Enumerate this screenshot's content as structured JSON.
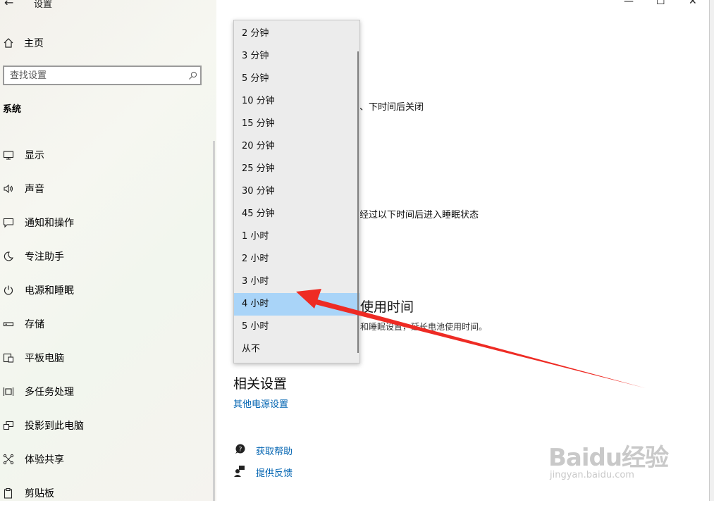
{
  "window": {
    "title": "设置",
    "back_glyph": "←",
    "minimize_glyph": "—",
    "maximize_glyph": "☐",
    "close_glyph": "✕"
  },
  "sidebar": {
    "home_label": "主页",
    "search_placeholder": "查找设置",
    "section_title": "系统",
    "items": [
      {
        "label": "显示",
        "icon": "monitor-icon"
      },
      {
        "label": "声音",
        "icon": "speaker-icon"
      },
      {
        "label": "通知和操作",
        "icon": "notification-icon"
      },
      {
        "label": "专注助手",
        "icon": "moon-icon"
      },
      {
        "label": "电源和睡眠",
        "icon": "power-icon"
      },
      {
        "label": "存储",
        "icon": "storage-icon"
      },
      {
        "label": "平板电脑",
        "icon": "tablet-icon"
      },
      {
        "label": "多任务处理",
        "icon": "multitask-icon"
      },
      {
        "label": "投影到此电脑",
        "icon": "project-icon"
      },
      {
        "label": "体验共享",
        "icon": "share-icon"
      },
      {
        "label": "剪贴板",
        "icon": "clipboard-icon"
      }
    ]
  },
  "main": {
    "screen_fragment": "、下时间后关闭",
    "sleep_fragment": "经过以下时间后进入睡眠状态",
    "battery_heading_fragment": "使用时间",
    "battery_desc_fragment": "和睡眠设置，延长电池使用时间。",
    "related_title": "相关设置",
    "related_link": "其他电源设置",
    "help_label": "获取帮助",
    "feedback_label": "提供反馈"
  },
  "dropdown": {
    "options": [
      "2 分钟",
      "3 分钟",
      "5 分钟",
      "10 分钟",
      "15 分钟",
      "20 分钟",
      "25 分钟",
      "30 分钟",
      "45 分钟",
      "1 小时",
      "2 小时",
      "3 小时",
      "4 小时",
      "5 小时",
      "从不"
    ],
    "selected": "4 小时"
  },
  "watermark": {
    "main": "Baidu经验",
    "sub": "jingyan.baidu.com"
  },
  "colors": {
    "link": "#0063b1",
    "selected_option": "#a9d4f8",
    "arrow": "#ee2b24"
  }
}
